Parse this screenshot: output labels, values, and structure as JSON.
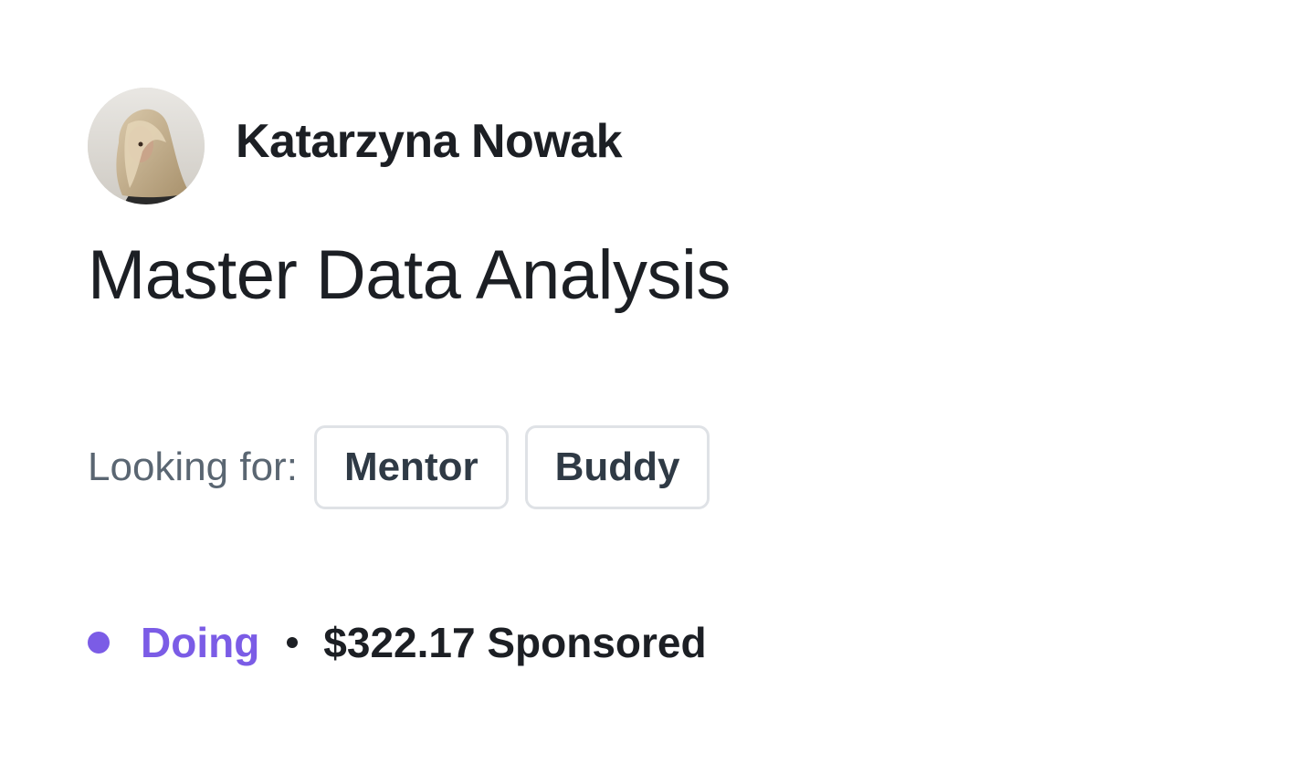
{
  "author": {
    "name": "Katarzyna Nowak",
    "avatar": "avatar-photo"
  },
  "goal": {
    "title": "Master Data Analysis"
  },
  "looking_for": {
    "label": "Looking for:",
    "chips": [
      "Mentor",
      "Buddy"
    ]
  },
  "status": {
    "label": "Doing",
    "color": "#7b5ce6",
    "separator_icon": "bullet-dot-icon",
    "sponsored": "$322.17 Sponsored"
  },
  "colors": {
    "text": "#1c1f24",
    "muted": "#5a6672",
    "chip_border": "#dfe2e6",
    "accent": "#7b5ce6"
  }
}
